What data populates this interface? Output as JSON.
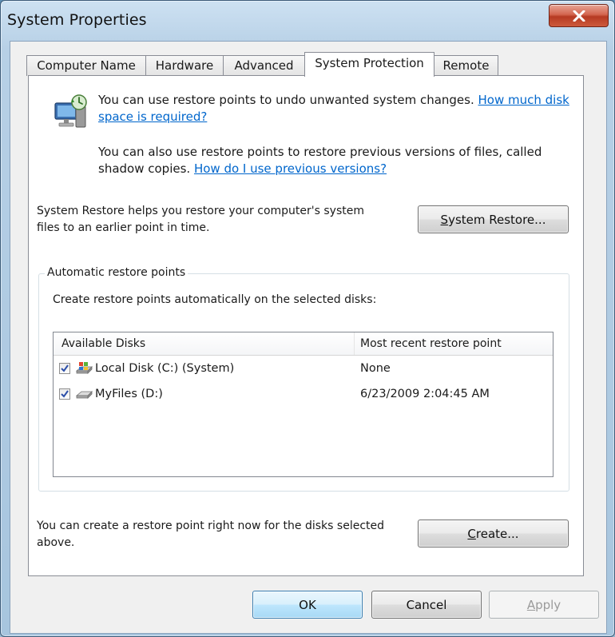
{
  "window": {
    "title": "System Properties"
  },
  "tabs": [
    {
      "label": "Computer Name"
    },
    {
      "label": "Hardware"
    },
    {
      "label": "Advanced"
    },
    {
      "label": "System Protection"
    },
    {
      "label": "Remote"
    }
  ],
  "active_tab": "System Protection",
  "protection": {
    "intro1_text": "You can use restore points to undo unwanted system changes. ",
    "intro1_link": "How much disk space is required?",
    "intro2_text": "You can also use restore points to restore previous versions of files, called shadow copies. ",
    "intro2_link": "How do I use previous versions?",
    "restore_desc": "System Restore helps you restore your computer's system files to an earlier point in time.",
    "restore_button_pre": "",
    "restore_button_accel": "S",
    "restore_button_post": "ystem Restore...",
    "group_label": "Automatic restore points",
    "group_desc": "Create restore points automatically on the selected disks:",
    "columns": [
      "Available Disks",
      "Most recent restore point"
    ],
    "disks": [
      {
        "name": "Local Disk (C:) (System)",
        "recent": "None",
        "checked": true,
        "icon": "system-drive-icon"
      },
      {
        "name": "MyFiles (D:)",
        "recent": "6/23/2009 2:04:45 AM",
        "checked": true,
        "icon": "hard-drive-icon"
      }
    ],
    "create_desc": "You can create a restore point right now for the disks selected above.",
    "create_button_accel": "C",
    "create_button_post": "reate..."
  },
  "footer": {
    "ok_label": "OK",
    "cancel_label": "Cancel",
    "apply_accel": "A",
    "apply_post": "pply"
  },
  "colors": {
    "link": "#0066cc",
    "close_button": "#c7432a",
    "checkmark": "#2b4ea8"
  }
}
